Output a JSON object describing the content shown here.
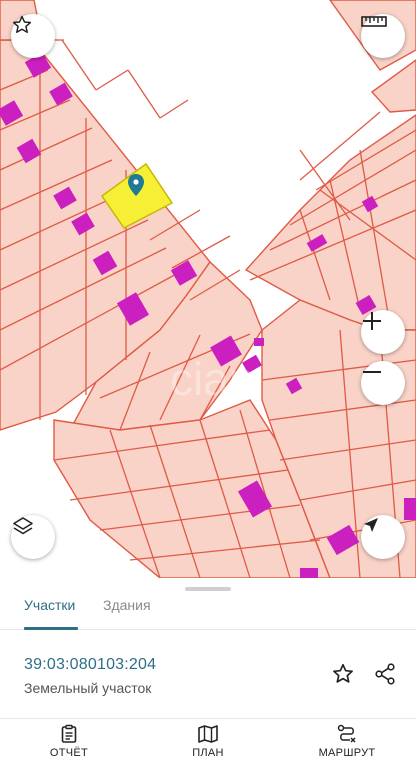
{
  "tabs": {
    "parcels": "Участки",
    "buildings": "Здания"
  },
  "parcel": {
    "cadastral_number": "39:03:080103:204",
    "type": "Земельный участок"
  },
  "bottom_nav": {
    "report": "ОТЧЁТ",
    "plan": "ПЛАН",
    "route": "МАРШРУТ"
  },
  "colors": {
    "parcel_fill": "#f9d3c8",
    "parcel_border": "#e05a45",
    "building": "#cc1fc0",
    "selected_parcel": "#f6ef36",
    "accent": "#2e6f87"
  }
}
